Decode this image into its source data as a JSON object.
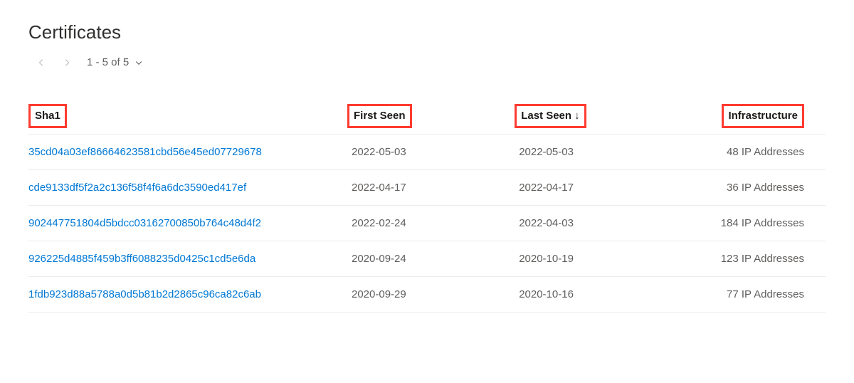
{
  "title": "Certificates",
  "pagination": {
    "label": "1 - 5 of 5"
  },
  "columns": {
    "sha1": "Sha1",
    "first_seen": "First Seen",
    "last_seen": "Last Seen",
    "sort_indicator": "↓",
    "infrastructure": "Infrastructure"
  },
  "rows": [
    {
      "sha1": "35cd04a03ef86664623581cbd56e45ed07729678",
      "first_seen": "2022-05-03",
      "last_seen": "2022-05-03",
      "infra": "48 IP Addresses"
    },
    {
      "sha1": "cde9133df5f2a2c136f58f4f6a6dc3590ed417ef",
      "first_seen": "2022-04-17",
      "last_seen": "2022-04-17",
      "infra": "36 IP Addresses"
    },
    {
      "sha1": "902447751804d5bdcc03162700850b764c48d4f2",
      "first_seen": "2022-02-24",
      "last_seen": "2022-04-03",
      "infra": "184 IP Addresses"
    },
    {
      "sha1": "926225d4885f459b3ff6088235d0425c1cd5e6da",
      "first_seen": "2020-09-24",
      "last_seen": "2020-10-19",
      "infra": "123 IP Addresses"
    },
    {
      "sha1": "1fdb923d88a5788a0d5b81b2d2865c96ca82c6ab",
      "first_seen": "2020-09-29",
      "last_seen": "2020-10-16",
      "infra": "77 IP Addresses"
    }
  ]
}
